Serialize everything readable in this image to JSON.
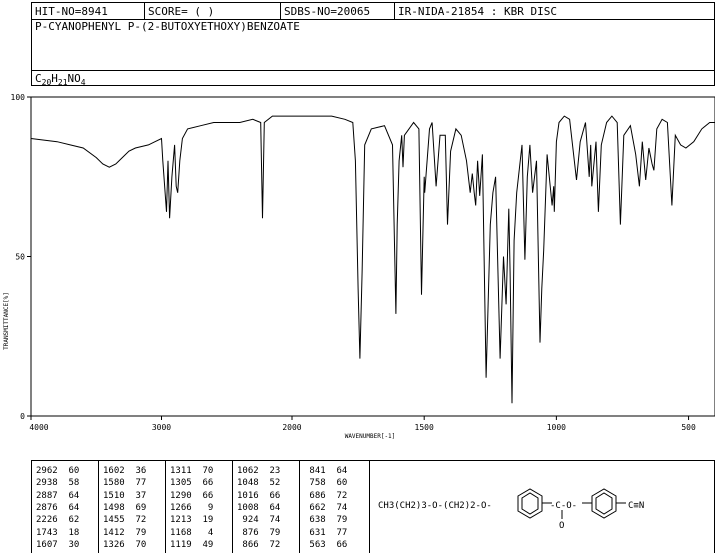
{
  "header": {
    "hit_no": "HIT-NO=8941",
    "score": "SCORE=  (   )",
    "sdbs_no": "SDBS-NO=20065",
    "technique": "IR-NIDA-21854 : KBR DISC"
  },
  "compound": {
    "name": "P-CYANOPHENYL P-(2-BUTOXYETHOXY)BENZOATE",
    "formula": "C20H21NO4"
  },
  "structure": {
    "left": "CH3(CH2)3-O-(CH2)2-O-",
    "ester": "-C-O-",
    "carbonyl": "O",
    "nitrile": "C≡N"
  },
  "chart_data": {
    "type": "line",
    "title": "",
    "xlabel": "WAVENUMBER[-1]",
    "ylabel": "TRANSMITTANCE[%]",
    "xlim": [
      4000,
      400
    ],
    "ylim": [
      0,
      100
    ],
    "x_ticks": [
      "4000",
      "3000",
      "2000",
      "1500",
      "1000",
      "500"
    ],
    "y_ticks": [
      "100",
      "50",
      "0"
    ],
    "grid": false,
    "series": [
      {
        "x": [
          4000,
          3900,
          3800,
          3700,
          3600,
          3500,
          3450,
          3400,
          3350,
          3300,
          3250,
          3200,
          3100,
          3050,
          3000,
          2990,
          2962,
          2950,
          2938,
          2920,
          2900,
          2887,
          2876,
          2860,
          2840,
          2800,
          2700,
          2600,
          2400,
          2300,
          2240,
          2226,
          2212,
          2150,
          2000,
          1900,
          1850,
          1800,
          1770,
          1760,
          1750,
          1743,
          1735,
          1725,
          1700,
          1650,
          1620,
          1607,
          1602,
          1595,
          1585,
          1580,
          1575,
          1540,
          1520,
          1510,
          1500,
          1498,
          1480,
          1470,
          1455,
          1440,
          1420,
          1412,
          1400,
          1380,
          1360,
          1340,
          1326,
          1318,
          1311,
          1305,
          1298,
          1290,
          1280,
          1266,
          1250,
          1240,
          1230,
          1213,
          1200,
          1190,
          1180,
          1175,
          1168,
          1160,
          1150,
          1130,
          1119,
          1110,
          1100,
          1090,
          1075,
          1062,
          1055,
          1048,
          1035,
          1016,
          1010,
          1008,
          1000,
          990,
          970,
          950,
          924,
          910,
          890,
          876,
          870,
          866,
          850,
          841,
          830,
          810,
          790,
          770,
          758,
          745,
          720,
          700,
          686,
          675,
          662,
          650,
          638,
          631,
          620,
          600,
          580,
          563,
          550,
          530,
          510,
          480,
          450,
          420,
          400
        ],
        "y": [
          87,
          86.5,
          86,
          85,
          84,
          81,
          79,
          78,
          79,
          81,
          83,
          84,
          85,
          86,
          87,
          80,
          64,
          80,
          62,
          75,
          85,
          72,
          70,
          80,
          87,
          90,
          91,
          92,
          92,
          93,
          92,
          62,
          92,
          94,
          94,
          94,
          94,
          93,
          92,
          80,
          40,
          18,
          45,
          85,
          90,
          91,
          85,
          32,
          60,
          80,
          88,
          78,
          88,
          92,
          90,
          38,
          75,
          70,
          90,
          92,
          72,
          88,
          88,
          60,
          83,
          90,
          88,
          80,
          70,
          76,
          70,
          66,
          80,
          69,
          82,
          12,
          60,
          70,
          75,
          18,
          50,
          35,
          65,
          45,
          4,
          55,
          70,
          85,
          49,
          75,
          85,
          70,
          80,
          23,
          40,
          52,
          82,
          66,
          72,
          64,
          86,
          92,
          94,
          93,
          74,
          86,
          92,
          75,
          85,
          72,
          86,
          64,
          85,
          92,
          94,
          92,
          60,
          88,
          91,
          82,
          72,
          86,
          74,
          84,
          79,
          77,
          90,
          93,
          92,
          66,
          88,
          85,
          84,
          86,
          90,
          92,
          92
        ]
      }
    ],
    "peak_table": [
      [
        2962,
        60
      ],
      [
        2938,
        58
      ],
      [
        2887,
        64
      ],
      [
        2876,
        64
      ],
      [
        2226,
        62
      ],
      [
        1743,
        18
      ],
      [
        1607,
        30
      ],
      [
        1602,
        36
      ],
      [
        1580,
        77
      ],
      [
        1510,
        37
      ],
      [
        1498,
        69
      ],
      [
        1455,
        72
      ],
      [
        1412,
        79
      ],
      [
        1326,
        70
      ],
      [
        1311,
        70
      ],
      [
        1305,
        66
      ],
      [
        1290,
        66
      ],
      [
        1266,
        9
      ],
      [
        1213,
        19
      ],
      [
        1168,
        4
      ],
      [
        1119,
        49
      ],
      [
        1062,
        23
      ],
      [
        1048,
        52
      ],
      [
        1016,
        66
      ],
      [
        1008,
        64
      ],
      [
        924,
        74
      ],
      [
        876,
        79
      ],
      [
        866,
        72
      ],
      [
        841,
        64
      ],
      [
        758,
        60
      ],
      [
        686,
        72
      ],
      [
        662,
        74
      ],
      [
        638,
        79
      ],
      [
        631,
        77
      ],
      [
        563,
        66
      ]
    ]
  }
}
